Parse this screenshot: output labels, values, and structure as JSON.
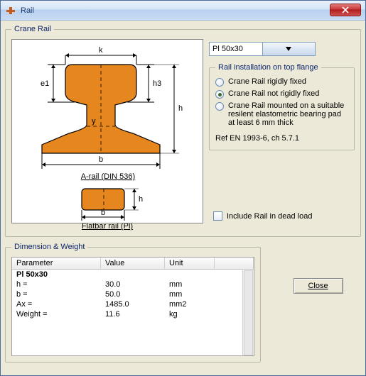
{
  "window": {
    "title": "Rail"
  },
  "crane_rail": {
    "legend": "Crane Rail",
    "diagram": {
      "a_rail_caption": "A-rail (DIN 536)",
      "flatbar_caption": "Flatbar rail (Pl)",
      "labels": {
        "k": "k",
        "e1": "e1",
        "h3": "h3",
        "h": "h",
        "y": "y",
        "b": "b"
      }
    },
    "rail_select": {
      "value": "Pl 50x30"
    },
    "install": {
      "legend": "Rail installation on top flange",
      "options": [
        {
          "label": "Crane Rail rigidly fixed",
          "selected": false
        },
        {
          "label": "Crane Rail not rigidly fixed",
          "selected": true
        },
        {
          "label": "Crane Rail mounted on a suitable resilent elastometric bearing pad at least 6 mm thick",
          "selected": false
        }
      ],
      "ref": "Ref EN 1993-6, ch 5.7.1"
    },
    "include_dead_load": {
      "label": "Include Rail in dead load",
      "checked": false
    }
  },
  "dim": {
    "legend": "Dimension & Weight",
    "headers": {
      "param": "Parameter",
      "value": "Value",
      "unit": "Unit"
    },
    "title_row": "Pl 50x30",
    "rows": [
      {
        "param": "h =",
        "value": "30.0",
        "unit": "mm"
      },
      {
        "param": "b =",
        "value": "50.0",
        "unit": "mm"
      },
      {
        "param": "Ax =",
        "value": "1485.0",
        "unit": "mm2"
      },
      {
        "param": "Weight =",
        "value": "11.6",
        "unit": "kg"
      }
    ]
  },
  "buttons": {
    "close": "Close"
  }
}
